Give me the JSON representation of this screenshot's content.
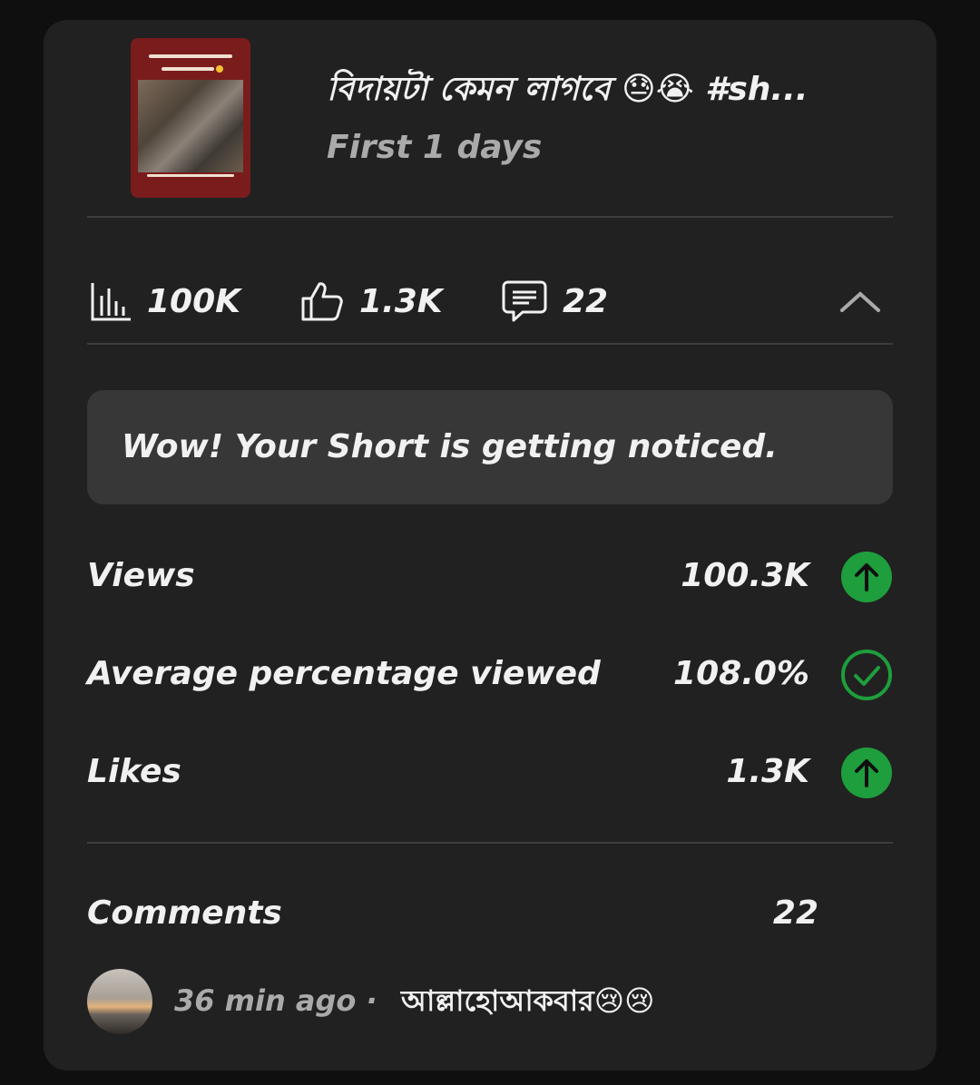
{
  "video": {
    "title": "বিদায়টা কেমন লাগবে 😓😭 #sh...",
    "period": "First 1 days",
    "thumbnail_icon": "video-thumbnail"
  },
  "stats": {
    "views": "100K",
    "likes": "1.3K",
    "comments": "22",
    "views_icon": "bar-chart-icon",
    "likes_icon": "thumbs-up-icon",
    "comments_icon": "comment-icon",
    "collapse_icon": "chevron-up-icon"
  },
  "banner": {
    "text": "Wow! Your Short is getting noticed."
  },
  "metrics": [
    {
      "label": "Views",
      "value": "100.3K",
      "icon": "arrow-up-circle-icon"
    },
    {
      "label": "Average percentage viewed",
      "value": "108.0%",
      "icon": "check-circle-icon"
    },
    {
      "label": "Likes",
      "value": "1.3K",
      "icon": "arrow-up-circle-icon"
    }
  ],
  "comments_section": {
    "label": "Comments",
    "count": "22",
    "latest": {
      "time": "36 min ago · ",
      "text": "আল্লাহোআকবার😢😢"
    }
  },
  "colors": {
    "background": "#0f0f0f",
    "card": "#212121",
    "banner": "#373737",
    "accent_green": "#1e9e3c",
    "muted_text": "#aaaaaa"
  }
}
